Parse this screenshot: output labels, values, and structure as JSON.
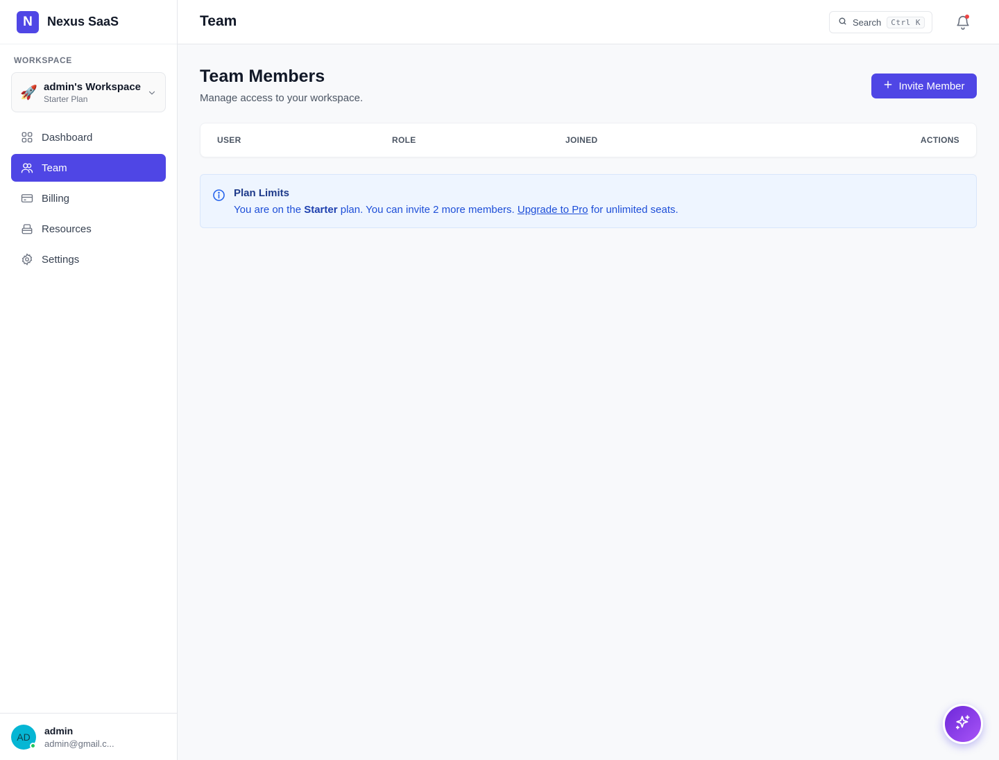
{
  "app": {
    "logo_letter": "N",
    "name": "Nexus SaaS"
  },
  "sidebar": {
    "workspace_label": "WORKSPACE",
    "workspace": {
      "emoji": "🚀",
      "name": "admin's Workspace",
      "plan": "Starter Plan"
    },
    "items": [
      {
        "label": "Dashboard",
        "icon": "grid-icon",
        "active": false
      },
      {
        "label": "Team",
        "icon": "users-icon",
        "active": true
      },
      {
        "label": "Billing",
        "icon": "credit-card-icon",
        "active": false
      },
      {
        "label": "Resources",
        "icon": "archive-icon",
        "active": false
      },
      {
        "label": "Settings",
        "icon": "gear-icon",
        "active": false
      }
    ],
    "user": {
      "initials": "AD",
      "name": "admin",
      "email": "admin@gmail.c..."
    }
  },
  "header": {
    "title": "Team",
    "search_label": "Search",
    "search_shortcut": "Ctrl K"
  },
  "main": {
    "title": "Team Members",
    "subtitle": "Manage access to your workspace.",
    "invite_label": "Invite Member",
    "table": {
      "columns": [
        "USER",
        "ROLE",
        "JOINED",
        "ACTIONS"
      ]
    },
    "notice": {
      "title": "Plan Limits",
      "text_before": "You are on the ",
      "plan": "Starter",
      "text_middle": " plan. You can invite 2 more members. ",
      "link": "Upgrade to Pro",
      "text_after": " for unlimited seats."
    }
  },
  "colors": {
    "accent": "#4f46e5",
    "notice_bg": "#eef5ff",
    "notification_dot": "#ef4444",
    "online": "#22c55e"
  }
}
